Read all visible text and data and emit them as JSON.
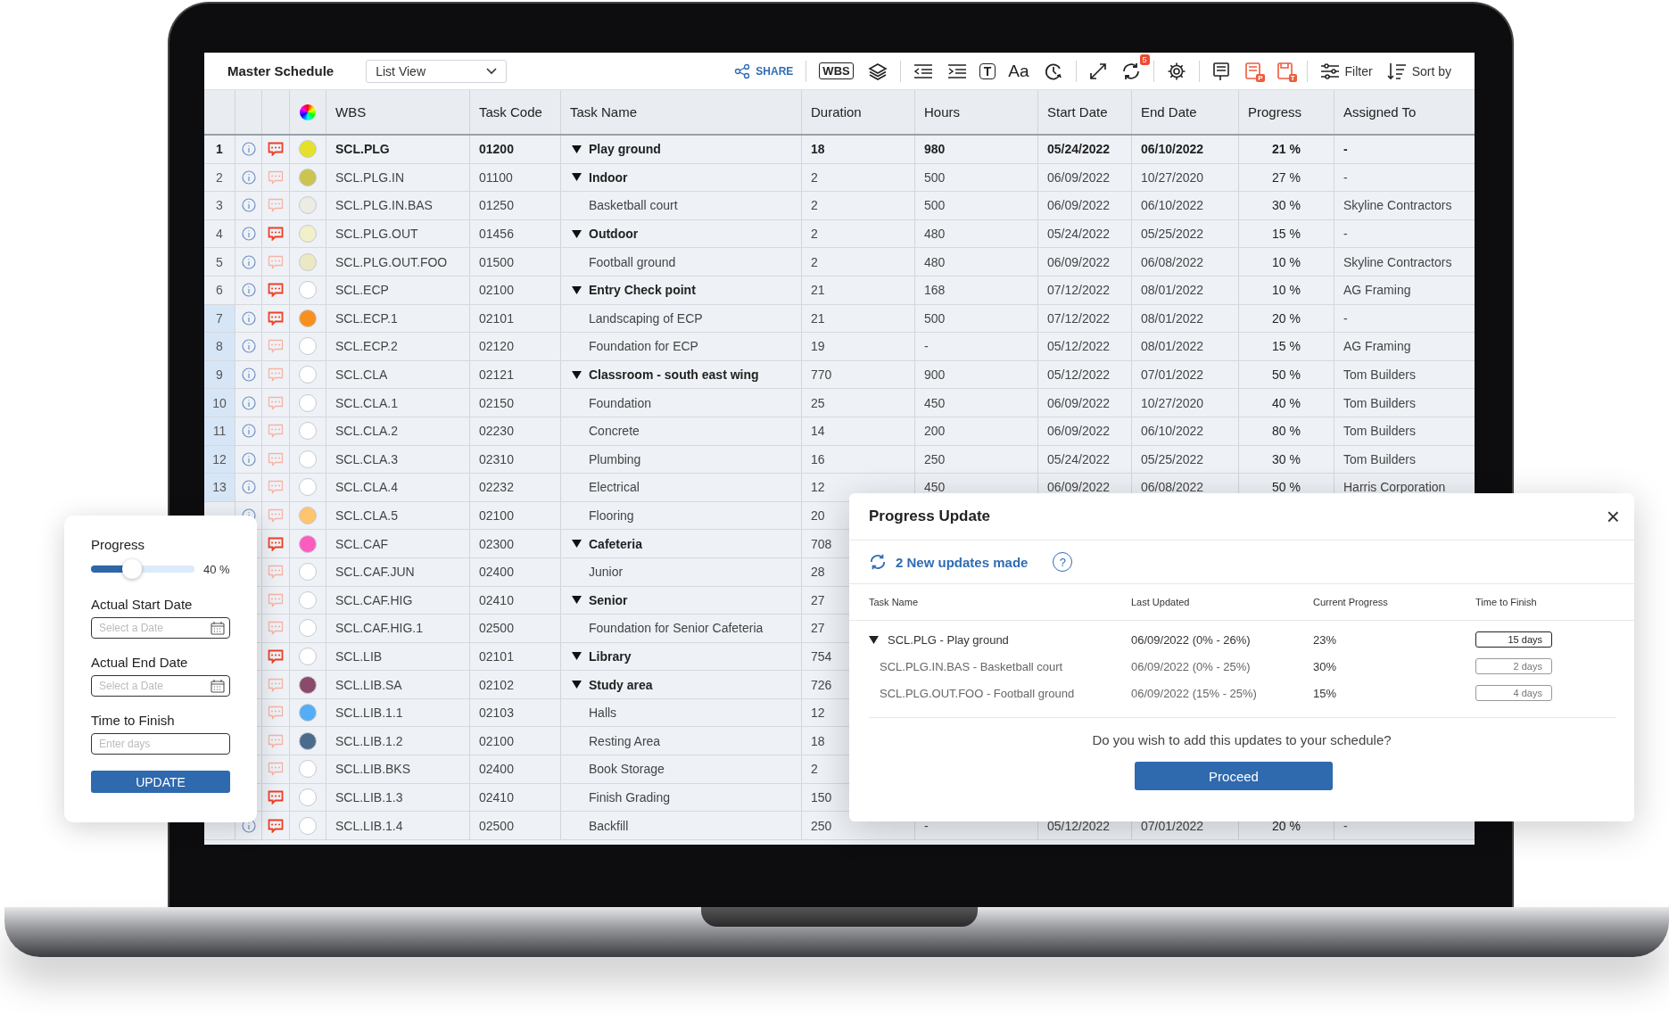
{
  "toolbar": {
    "title": "Master Schedule",
    "view": "List View",
    "groups": [
      [
        {
          "kind": "share",
          "label": "SHARE"
        }
      ],
      [
        {
          "kind": "wbs",
          "label": "WBS"
        },
        {
          "kind": "layers"
        }
      ],
      [
        {
          "kind": "outdent"
        },
        {
          "kind": "indent"
        },
        {
          "kind": "textbox",
          "label": "T"
        },
        {
          "kind": "font",
          "label": "Aa"
        },
        {
          "kind": "clock"
        }
      ],
      [
        {
          "kind": "expand"
        },
        {
          "kind": "refresh",
          "badge": "5"
        }
      ],
      [
        {
          "kind": "settings"
        }
      ],
      [
        {
          "kind": "note"
        },
        {
          "kind": "note-red",
          "label": "P"
        },
        {
          "kind": "save-red",
          "label": "T"
        }
      ],
      [
        {
          "kind": "filter",
          "label": "Filter"
        },
        {
          "kind": "sort",
          "label": "Sort by"
        }
      ]
    ]
  },
  "table": {
    "columns": [
      "WBS",
      "Task Code",
      "Task Name",
      "Duration",
      "Hours",
      "Start Date",
      "End Date",
      "Progress",
      "Assigned To"
    ],
    "rows": [
      {
        "num": "1",
        "info": true,
        "selected": false,
        "comment": true,
        "color": "#e5e12a",
        "bold": true,
        "wbs": "SCL.PLG",
        "code": "01200",
        "kind": "group",
        "expanded": true,
        "name": "Play ground",
        "duration": "18",
        "hours": "980",
        "start": "05/24/2022",
        "end": "06/10/2022",
        "progress": "21 %",
        "assigned": "-"
      },
      {
        "num": "2",
        "info": true,
        "selected": false,
        "comment": false,
        "color": "#cbc44f",
        "bold": false,
        "wbs": "SCL.PLG.IN",
        "code": "01100",
        "kind": "group",
        "expanded": true,
        "name": "Indoor",
        "duration": "2",
        "hours": "500",
        "start": "06/09/2022",
        "end": "10/27/2020",
        "progress": "27 %",
        "assigned": "-"
      },
      {
        "num": "3",
        "info": true,
        "selected": false,
        "comment": false,
        "color": "#ecebe4",
        "bold": false,
        "wbs": "SCL.PLG.IN.BAS",
        "code": "01250",
        "kind": "task",
        "name": "Basketball court",
        "duration": "2",
        "hours": "500",
        "start": "06/09/2022",
        "end": "06/10/2022",
        "progress": "30 %",
        "assigned": "Skyline Contractors"
      },
      {
        "num": "4",
        "info": true,
        "selected": false,
        "comment": true,
        "color": "#f2f0c8",
        "bold": false,
        "wbs": "SCL.PLG.OUT",
        "code": "01456",
        "kind": "group",
        "expanded": true,
        "name": "Outdoor",
        "duration": "2",
        "hours": "480",
        "start": "05/24/2022",
        "end": "05/25/2022",
        "progress": "15 %",
        "assigned": "-"
      },
      {
        "num": "5",
        "info": true,
        "selected": false,
        "comment": false,
        "color": "#ebe9c4",
        "bold": false,
        "wbs": "SCL.PLG.OUT.FOO",
        "code": "01500",
        "kind": "task",
        "name": "Football ground",
        "duration": "2",
        "hours": "480",
        "start": "06/09/2022",
        "end": "06/08/2022",
        "progress": "10 %",
        "assigned": "Skyline Contractors"
      },
      {
        "num": "6",
        "info": true,
        "selected": false,
        "comment": true,
        "color": "#ffffff",
        "bold": false,
        "wbs": "SCL.ECP",
        "code": "02100",
        "kind": "group",
        "expanded": true,
        "name": "Entry Check point",
        "duration": "21",
        "hours": "168",
        "start": "07/12/2022",
        "end": "08/01/2022",
        "progress": "10 %",
        "assigned": "AG Framing"
      },
      {
        "num": "7",
        "info": true,
        "selected": true,
        "comment": true,
        "color": "#f7901e",
        "bold": false,
        "wbs": "SCL.ECP.1",
        "code": "02101",
        "kind": "task",
        "name": "Landscaping of ECP",
        "duration": "21",
        "hours": "500",
        "start": "07/12/2022",
        "end": "08/01/2022",
        "progress": "20 %",
        "assigned": "-"
      },
      {
        "num": "8",
        "info": true,
        "selected": true,
        "comment": false,
        "color": "#ffffff",
        "bold": false,
        "wbs": "SCL.ECP.2",
        "code": "02120",
        "kind": "task",
        "name": "Foundation for ECP",
        "duration": "19",
        "hours": "-",
        "start": "05/12/2022",
        "end": "08/01/2022",
        "progress": "15 %",
        "assigned": "AG Framing"
      },
      {
        "num": "9",
        "info": true,
        "selected": true,
        "comment": false,
        "color": "#ffffff",
        "bold": false,
        "wbs": "SCL.CLA",
        "code": "02121",
        "kind": "group",
        "expanded": true,
        "name": "Classroom - south east wing",
        "duration": "770",
        "hours": "900",
        "start": "05/12/2022",
        "end": "07/01/2022",
        "progress": "50 %",
        "assigned": "Tom Builders"
      },
      {
        "num": "10",
        "info": true,
        "selected": true,
        "comment": false,
        "color": "#ffffff",
        "bold": false,
        "wbs": "SCL.CLA.1",
        "code": "02150",
        "kind": "task",
        "name": "Foundation",
        "duration": "25",
        "hours": "450",
        "start": "06/09/2022",
        "end": "10/27/2020",
        "progress": "40 %",
        "assigned": "Tom Builders"
      },
      {
        "num": "11",
        "info": true,
        "selected": true,
        "comment": false,
        "color": "#ffffff",
        "bold": false,
        "wbs": "SCL.CLA.2",
        "code": "02230",
        "kind": "task",
        "name": "Concrete",
        "duration": "14",
        "hours": "200",
        "start": "06/09/2022",
        "end": "06/10/2022",
        "progress": "80 %",
        "assigned": "Tom Builders"
      },
      {
        "num": "12",
        "info": true,
        "selected": true,
        "comment": false,
        "color": "#ffffff",
        "bold": false,
        "wbs": "SCL.CLA.3",
        "code": "02310",
        "kind": "task",
        "name": "Plumbing",
        "duration": "16",
        "hours": "250",
        "start": "05/24/2022",
        "end": "05/25/2022",
        "progress": "30 %",
        "assigned": "Tom Builders"
      },
      {
        "num": "13",
        "info": true,
        "selected": true,
        "comment": false,
        "color": "#ffffff",
        "bold": false,
        "wbs": "SCL.CLA.4",
        "code": "02232",
        "kind": "task",
        "name": "Electrical",
        "duration": "12",
        "hours": "450",
        "start": "06/09/2022",
        "end": "06/08/2022",
        "progress": "50 %",
        "assigned": "Harris Corporation"
      },
      {
        "info": true,
        "comment": false,
        "color": "#fec46e",
        "bold": false,
        "wbs": "SCL.CLA.5",
        "code": "02100",
        "kind": "task",
        "name": "Flooring",
        "duration": "20"
      },
      {
        "comment": true,
        "color": "#fd5cbf",
        "bold": false,
        "wbs": "SCL.CAF",
        "code": "02300",
        "kind": "group",
        "expanded": true,
        "name": "Cafeteria",
        "duration": "708"
      },
      {
        "comment": false,
        "color": "#ffffff",
        "bold": false,
        "wbs": "SCL.CAF.JUN",
        "code": "02400",
        "kind": "task",
        "name": "Junior",
        "duration": "28"
      },
      {
        "comment": false,
        "color": "#ffffff",
        "bold": false,
        "wbs": "SCL.CAF.HIG",
        "code": "02410",
        "kind": "group",
        "expanded": true,
        "name": "Senior",
        "duration": "27"
      },
      {
        "comment": false,
        "color": "#ffffff",
        "bold": false,
        "wbs": "SCL.CAF.HIG.1",
        "code": "02500",
        "kind": "task",
        "name": "Foundation for Senior Cafeteria",
        "duration": "27"
      },
      {
        "comment": true,
        "color": "#ffffff",
        "bold": false,
        "wbs": "SCL.LIB",
        "code": "02101",
        "kind": "group",
        "expanded": true,
        "name": "Library",
        "duration": "754"
      },
      {
        "comment": false,
        "color": "#8a4a6c",
        "bold": false,
        "wbs": "SCL.LIB.SA",
        "code": "02102",
        "kind": "group",
        "expanded": true,
        "name": "Study area",
        "duration": "726"
      },
      {
        "comment": false,
        "color": "#55adf7",
        "bold": false,
        "wbs": "SCL.LIB.1.1",
        "code": "02103",
        "kind": "task",
        "name": "Halls",
        "duration": "12"
      },
      {
        "comment": false,
        "color": "#4b6b8c",
        "bold": false,
        "wbs": "SCL.LIB.1.2",
        "code": "02100",
        "kind": "task",
        "name": "Resting Area",
        "duration": "18"
      },
      {
        "comment": false,
        "color": "#ffffff",
        "bold": false,
        "wbs": "SCL.LIB.BKS",
        "code": "02400",
        "kind": "task",
        "name": "Book Storage",
        "duration": "2"
      },
      {
        "comment": true,
        "color": "#ffffff",
        "bold": false,
        "wbs": "SCL.LIB.1.3",
        "code": "02410",
        "kind": "task",
        "name": "Finish Grading",
        "duration": "150"
      },
      {
        "info": true,
        "comment": true,
        "color": "#ffffff",
        "bold": false,
        "wbs": "SCL.LIB.1.4",
        "code": "02500",
        "kind": "task",
        "name": "Backfill",
        "duration": "250",
        "hours": "-",
        "start": "05/12/2022",
        "end": "07/01/2022",
        "progress": "20 %",
        "assigned": "-"
      }
    ]
  },
  "update_panel": {
    "progress_label": "Progress",
    "level": 0.4,
    "reading": "40 %",
    "fields": [
      {
        "label": "Actual Start Date",
        "placeholder": "Select a Date",
        "kind": "date"
      },
      {
        "label": "Actual End Date",
        "placeholder": "Select a Date",
        "kind": "date"
      },
      {
        "label": "Time to Finish",
        "placeholder": "Enter days",
        "kind": "text"
      }
    ],
    "button": "UPDATE"
  },
  "dialog": {
    "title": "Progress Update",
    "close": "×",
    "updates": "2 New updates made",
    "help": "?",
    "columns": [
      "Task Name",
      "Last Updated",
      "Current Progress",
      "Time to Finish"
    ],
    "rows": [
      {
        "task": "SCL.PLG -  Play ground",
        "expanded": true,
        "last": "06/09/2022 (0% - 26%)",
        "progress": "23%",
        "finish": "15 days",
        "active": true,
        "children": [
          {
            "task": "SCL.PLG.IN.BAS - Basketball court",
            "last": "06/09/2022 (0% - 25%)",
            "progress": "30%",
            "finish": "2 days",
            "active": false
          },
          {
            "task": "SCL.PLG.OUT.FOO - Football ground",
            "last": "06/09/2022 (15% - 25%)",
            "progress": "15%",
            "finish": "4 days",
            "active": false
          }
        ]
      }
    ],
    "question": "Do you wish to add this updates to your schedule?",
    "button": "Proceed"
  }
}
